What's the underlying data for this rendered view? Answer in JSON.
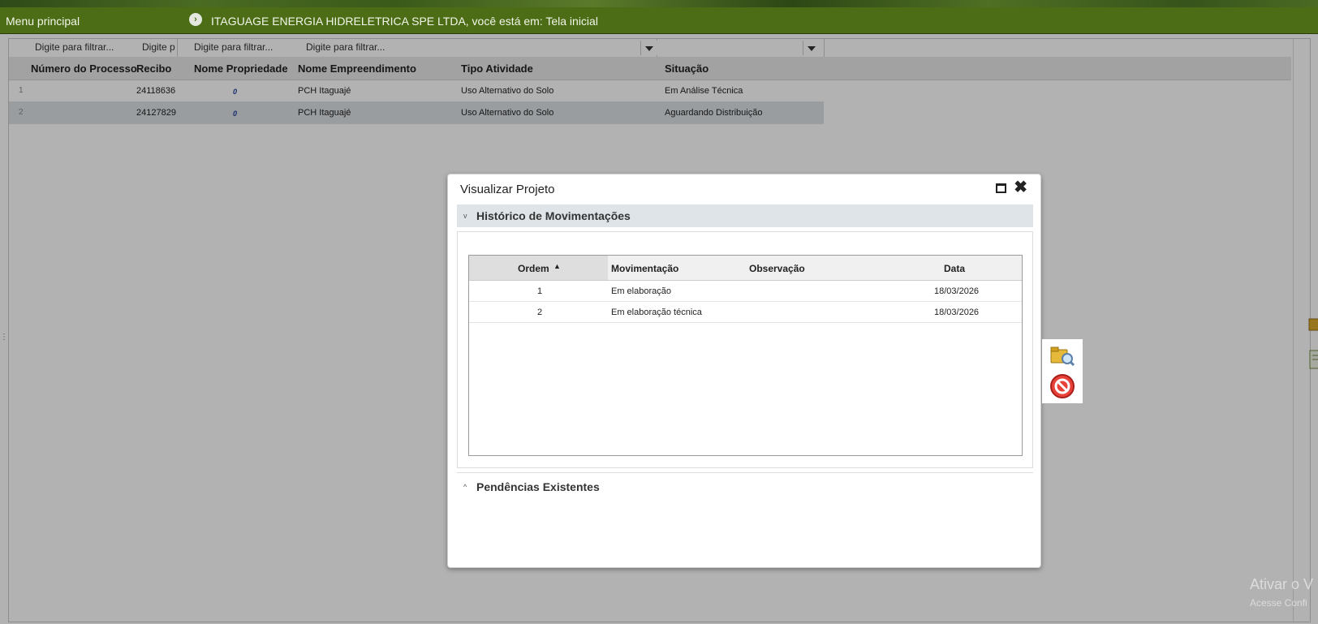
{
  "header": {
    "menu_label": "Menu principal",
    "breadcrumb": "ITAGUAGE ENERGIA HIDRELETRICA SPE LTDA, você está em: Tela inicial",
    "bar_color": "#4c6d15"
  },
  "grid": {
    "filters": [
      {
        "placeholder": "Digite para filtrar..."
      },
      {
        "placeholder": "Digite p"
      },
      {
        "placeholder": "Digite para filtrar..."
      },
      {
        "placeholder": "Digite para filtrar..."
      },
      {
        "placeholder": ""
      },
      {
        "placeholder": ""
      }
    ],
    "columns": [
      "Número do Processo",
      "Recibo",
      "Nome Propriedade",
      "Nome Empreendimento",
      "Tipo Atividade",
      "Situação"
    ],
    "rows": [
      {
        "num": "1",
        "processo": "",
        "recibo": "24118636",
        "propriedade": "0",
        "empreendimento": "PCH Itaguajé",
        "atividade": "Uso Alternativo do Solo",
        "situacao": "Em Análise Técnica"
      },
      {
        "num": "2",
        "processo": "",
        "recibo": "24127829",
        "propriedade": "0",
        "empreendimento": "PCH Itaguajé",
        "atividade": "Uso Alternativo do Solo",
        "situacao": "Aguardando Distribuição"
      }
    ]
  },
  "modal": {
    "title": "Visualizar Projeto",
    "section1": {
      "label": "Histórico de Movimentações",
      "columns": [
        "Ordem",
        "Movimentação",
        "Observação",
        "Data"
      ],
      "rows": [
        {
          "ordem": "1",
          "movimentacao": "Em elaboração",
          "observacao": "",
          "data": "18/03/2026"
        },
        {
          "ordem": "2",
          "movimentacao": "Em elaboração técnica",
          "observacao": "",
          "data": "18/03/2026"
        }
      ]
    },
    "section2": {
      "label": "Pendências Existentes"
    }
  },
  "watermark": {
    "line1": "Ativar o V",
    "line2": "Acesse Confi"
  }
}
